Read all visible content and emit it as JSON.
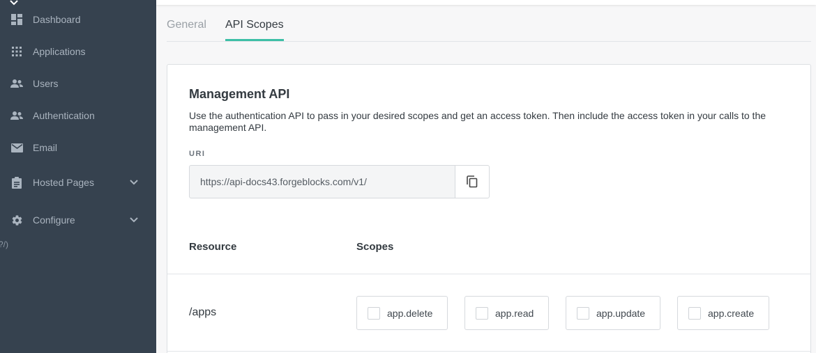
{
  "sidebar": {
    "items": [
      {
        "label": "Dashboard",
        "icon": "dashboard-icon"
      },
      {
        "label": "Applications",
        "icon": "apps-grid-icon"
      },
      {
        "label": "Users",
        "icon": "users-icon"
      },
      {
        "label": "Authentication",
        "icon": "authentication-icon"
      },
      {
        "label": "Email",
        "icon": "email-icon"
      },
      {
        "label": "Hosted Pages",
        "icon": "clipboard-icon"
      },
      {
        "label": "Configure",
        "icon": "gear-icon"
      }
    ],
    "stray_text": "?/)"
  },
  "tabs": [
    {
      "label": "General",
      "active": false
    },
    {
      "label": "API Scopes",
      "active": true
    }
  ],
  "card": {
    "title": "Management API",
    "description": "Use the authentication API to pass in your desired scopes and get an access token. Then include the access token in your calls to the management API.",
    "uri_label": "URI",
    "uri_value": "https://api-docs43.forgeblocks.com/v1/",
    "table": {
      "headers": [
        "Resource",
        "Scopes"
      ],
      "rows": [
        {
          "resource": "/apps",
          "scopes": [
            "app.delete",
            "app.read",
            "app.update",
            "app.create"
          ]
        }
      ]
    }
  },
  "colors": {
    "sidebar_bg": "#36424f",
    "accent": "#3dbfa6"
  }
}
